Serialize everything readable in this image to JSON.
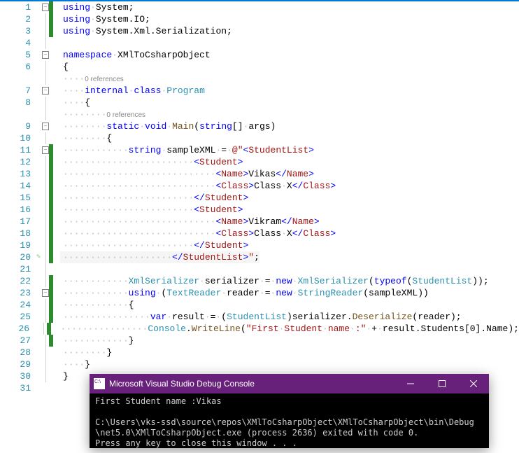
{
  "lines": [
    {
      "n": 1,
      "fold": "box-",
      "green": 1,
      "html": "<span class='kw'>using</span><span class='dot'>·</span>System;"
    },
    {
      "n": 2,
      "fold": "v",
      "green": 1,
      "html": "<span class='kw'>using</span><span class='dot'>·</span>System.IO;"
    },
    {
      "n": 3,
      "fold": "v",
      "green": 1,
      "html": "<span class='kw'>using</span><span class='dot'>·</span>System.Xml.Serialization;"
    },
    {
      "n": 4,
      "fold": "v",
      "green": 0,
      "html": ""
    },
    {
      "n": 5,
      "fold": "box-",
      "green": 0,
      "html": "<span class='kw'>namespace</span><span class='dot'>·</span>XMlToCsharpObject"
    },
    {
      "n": 6,
      "fold": "v",
      "green": 0,
      "html": "{"
    },
    {
      "n": "",
      "fold": "v",
      "green": 0,
      "ref": 1,
      "html": "<span class='dot'>····</span><span class='ref'>0 references</span>"
    },
    {
      "n": 7,
      "fold": "box-",
      "green": 0,
      "html": "<span class='dot'>····</span><span class='kw'>internal</span><span class='dot'>·</span><span class='kw'>class</span><span class='dot'>·</span><span class='type'>Program</span>"
    },
    {
      "n": 8,
      "fold": "v",
      "green": 0,
      "html": "<span class='dot'>····</span>{"
    },
    {
      "n": "",
      "fold": "v",
      "green": 0,
      "ref": 1,
      "html": "<span class='dot'>········</span><span class='ref'>0 references</span>"
    },
    {
      "n": 9,
      "fold": "box-",
      "green": 0,
      "html": "<span class='dot'>········</span><span class='kw'>static</span><span class='dot'>·</span><span class='kw'>void</span><span class='dot'>·</span><span class='method'>Main</span>(<span class='kw'>string</span>[]<span class='dot'>·</span>args)"
    },
    {
      "n": 10,
      "fold": "v",
      "green": 0,
      "html": "<span class='dot'>········</span>{"
    },
    {
      "n": 11,
      "fold": "box-",
      "green": 1,
      "html": "<span class='dot'>············</span><span class='kw'>string</span><span class='dot'>·</span>sampleXML<span class='dot'>·</span>=<span class='dot'>·</span><span class='str'>@\"</span><span class='xml-brk'>&lt;</span><span class='xml-tag'>StudentList</span><span class='xml-brk'>&gt;</span>"
    },
    {
      "n": 12,
      "fold": "v",
      "green": 1,
      "html": "<span class='dot'>························</span><span class='xml-brk'>&lt;</span><span class='xml-tag'>Student</span><span class='xml-brk'>&gt;</span>"
    },
    {
      "n": 13,
      "fold": "v",
      "green": 1,
      "html": "<span class='dot'>····························</span><span class='xml-brk'>&lt;</span><span class='xml-tag'>Name</span><span class='xml-brk'>&gt;</span><span class='xml-txt'>Vikas</span><span class='xml-brk'>&lt;/</span><span class='xml-tag'>Name</span><span class='xml-brk'>&gt;</span>"
    },
    {
      "n": 14,
      "fold": "v",
      "green": 1,
      "html": "<span class='dot'>····························</span><span class='xml-brk'>&lt;</span><span class='xml-tag'>Class</span><span class='xml-brk'>&gt;</span><span class='xml-txt'>Class</span><span class='dot'>·</span><span class='xml-txt'>X</span><span class='xml-brk'>&lt;/</span><span class='xml-tag'>Class</span><span class='xml-brk'>&gt;</span>"
    },
    {
      "n": 15,
      "fold": "v",
      "green": 1,
      "html": "<span class='dot'>························</span><span class='xml-brk'>&lt;/</span><span class='xml-tag'>Student</span><span class='xml-brk'>&gt;</span>"
    },
    {
      "n": 16,
      "fold": "v",
      "green": 1,
      "html": "<span class='dot'>························</span><span class='xml-brk'>&lt;</span><span class='xml-tag'>Student</span><span class='xml-brk'>&gt;</span>"
    },
    {
      "n": 17,
      "fold": "v",
      "green": 1,
      "html": "<span class='dot'>····························</span><span class='xml-brk'>&lt;</span><span class='xml-tag'>Name</span><span class='xml-brk'>&gt;</span><span class='xml-txt'>Vikram</span><span class='xml-brk'>&lt;/</span><span class='xml-tag'>Name</span><span class='xml-brk'>&gt;</span>"
    },
    {
      "n": 18,
      "fold": "v",
      "green": 1,
      "html": "<span class='dot'>····························</span><span class='xml-brk'>&lt;</span><span class='xml-tag'>Class</span><span class='xml-brk'>&gt;</span><span class='xml-txt'>Class</span><span class='dot'>·</span><span class='xml-txt'>X</span><span class='xml-brk'>&lt;/</span><span class='xml-tag'>Class</span><span class='xml-brk'>&gt;</span>"
    },
    {
      "n": 19,
      "fold": "v",
      "green": 1,
      "html": "<span class='dot'>························</span><span class='xml-brk'>&lt;/</span><span class='xml-tag'>Student</span><span class='xml-brk'>&gt;</span>"
    },
    {
      "n": 20,
      "fold": "v",
      "green": 1,
      "brush": 1,
      "cur": 1,
      "html": "<span class='dot'>····················</span><span class='xml-brk'>&lt;/</span><span class='xml-tag'>StudentList</span><span class='xml-brk'>&gt;</span><span class='str'>\"</span>;"
    },
    {
      "n": 21,
      "fold": "v",
      "green": 0,
      "html": ""
    },
    {
      "n": 22,
      "fold": "v",
      "green": 1,
      "html": "<span class='dot'>············</span><span class='type'>XmlSerializer</span><span class='dot'>·</span>serializer<span class='dot'>·</span>=<span class='dot'>·</span><span class='kw'>new</span><span class='dot'>·</span><span class='type'>XmlSerializer</span>(<span class='kw'>typeof</span>(<span class='type'>StudentList</span>));"
    },
    {
      "n": 23,
      "fold": "box-",
      "green": 1,
      "html": "<span class='dot'>············</span><span class='kw'>using</span><span class='dot'>·</span>(<span class='type'>TextReader</span><span class='dot'>·</span>reader<span class='dot'>·</span>=<span class='dot'>·</span><span class='kw'>new</span><span class='dot'>·</span><span class='type'>StringReader</span>(sampleXML))"
    },
    {
      "n": 24,
      "fold": "v",
      "green": 1,
      "html": "<span class='dot'>············</span>{"
    },
    {
      "n": 25,
      "fold": "v",
      "green": 1,
      "html": "<span class='dot'>················</span><span class='kw'>var</span><span class='dot'>·</span>result<span class='dot'>·</span>=<span class='dot'>·</span>(<span class='type'>StudentList</span>)serializer.<span class='method'>Deserialize</span>(reader);"
    },
    {
      "n": 26,
      "fold": "v",
      "green": 1,
      "html": "<span class='dot'>················</span><span class='type'>Console</span>.<span class='method'>WriteLine</span>(<span class='str'>\"First</span><span class='dot'>·</span><span class='str'>Student</span><span class='dot'>·</span><span class='str'>name</span><span class='dot'>·</span><span class='str'>:\"</span><span class='dot'>·</span>+<span class='dot'>·</span>result.Students[0].Name);"
    },
    {
      "n": 27,
      "fold": "v",
      "green": 1,
      "html": "<span class='dot'>············</span>}"
    },
    {
      "n": 28,
      "fold": "v",
      "green": 0,
      "html": "<span class='dot'>········</span>}"
    },
    {
      "n": 29,
      "fold": "v",
      "green": 0,
      "html": "<span class='dot'>····</span>}"
    },
    {
      "n": 30,
      "fold": "v",
      "green": 0,
      "html": "}"
    },
    {
      "n": 31,
      "fold": "",
      "green": 0,
      "html": ""
    }
  ],
  "console": {
    "title": "Microsoft Visual Studio Debug Console",
    "out": "First Student name :Vikas\n\nC:\\Users\\vks-ssd\\source\\repos\\XMlToCsharpObject\\XMlToCsharpObject\\bin\\Debug\\net5.0\\XMlToCsharpObject.exe (process 2636) exited with code 0.\nPress any key to close this window . . ."
  }
}
